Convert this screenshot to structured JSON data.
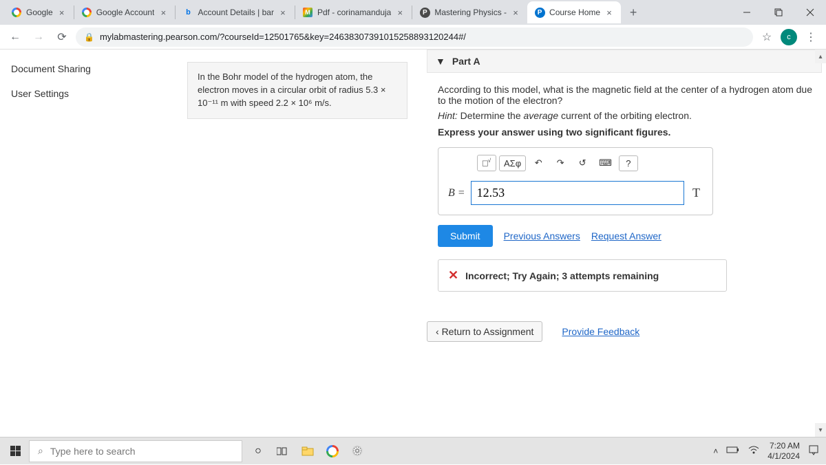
{
  "tabs": [
    {
      "title": "Google"
    },
    {
      "title": "Google Account"
    },
    {
      "title": "Account Details | bar"
    },
    {
      "title": "Pdf - corinamanduja"
    },
    {
      "title": "Mastering Physics - "
    },
    {
      "title": "Course Home"
    }
  ],
  "url": "mylabmastering.pearson.com/?courseId=12501765&key=24638307391015258893120244#/",
  "left_nav": {
    "doc_sharing": "Document Sharing",
    "user_settings": "User Settings"
  },
  "prompt_html": "In the Bohr model of the hydrogen atom, the electron moves in a circular orbit of radius 5.3 × 10⁻¹¹ m with speed 2.2 × 10⁶ m/s.",
  "part": {
    "label": "Part A",
    "question": "According to this model, what is the magnetic field at the center of a hydrogen atom due to the motion of the electron?",
    "hint_label": "Hint:",
    "hint_text": " Determine the ",
    "hint_em": "average",
    "hint_text2": " current of the orbiting electron.",
    "express": "Express your answer using two significant figures.",
    "var": "B = ",
    "value": "12.53",
    "unit": "T",
    "tools": {
      "greek": "ΑΣφ",
      "help": "?"
    },
    "submit": "Submit",
    "prev": "Previous Answers",
    "req": "Request Answer",
    "feedback": "Incorrect; Try Again; 3 attempts remaining"
  },
  "bottom": {
    "return": "Return to Assignment",
    "feedback": "Provide Feedback"
  },
  "taskbar": {
    "search_placeholder": "Type here to search",
    "time": "7:20 AM",
    "date": "4/1/2024"
  }
}
